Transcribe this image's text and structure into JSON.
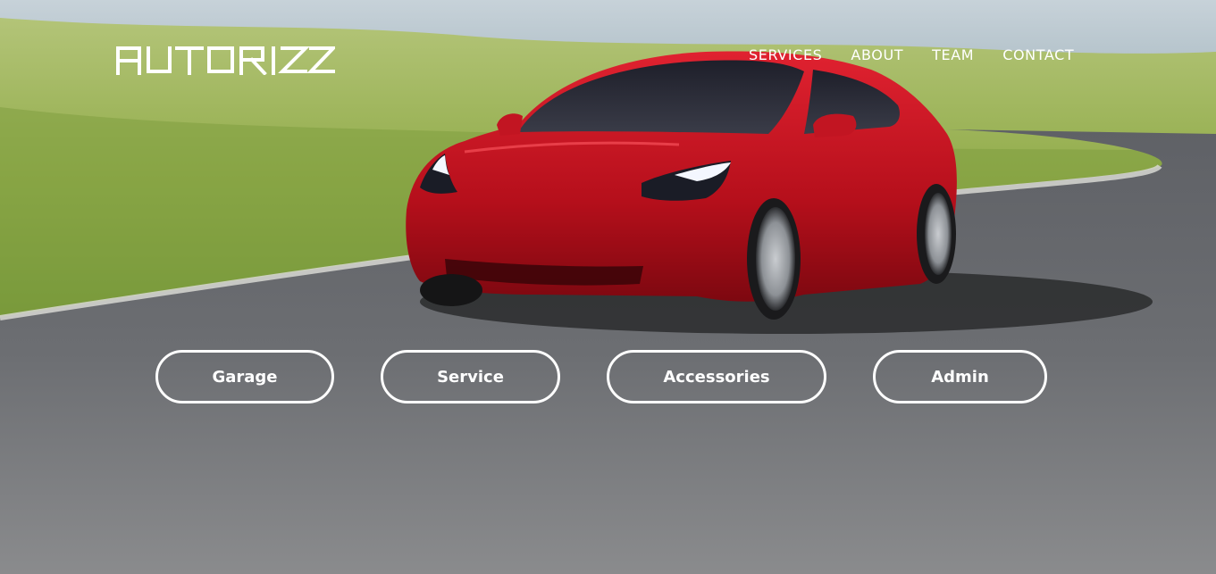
{
  "brand": {
    "logo_text": "AUTORIZZ"
  },
  "nav": {
    "items": [
      {
        "label": "SERVICES"
      },
      {
        "label": "ABOUT"
      },
      {
        "label": "TEAM"
      },
      {
        "label": "CONTACT"
      }
    ]
  },
  "actions": {
    "garage_label": "Garage",
    "service_label": "Service",
    "accessories_label": "Accessories",
    "admin_label": "Admin"
  },
  "colors": {
    "text": "#ffffff",
    "car_body": "#c0121e",
    "road": "#6f7175",
    "grass": "#8ea74a",
    "sky": "#b9c6cc"
  }
}
